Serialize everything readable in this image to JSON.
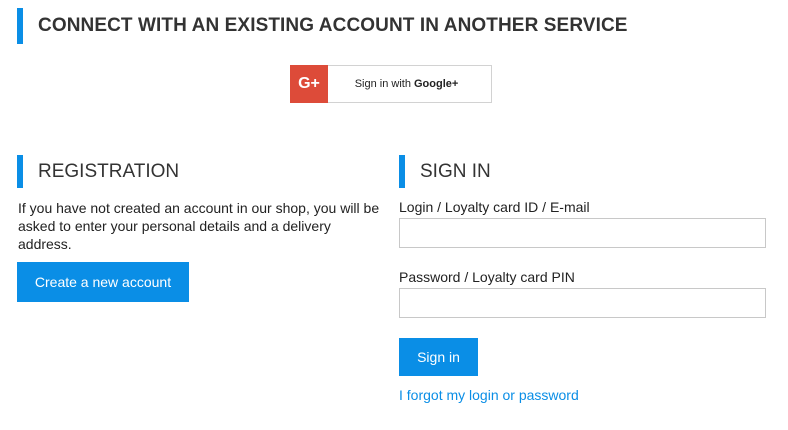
{
  "connect": {
    "title": "CONNECT WITH AN EXISTING ACCOUNT IN ANOTHER SERVICE",
    "google_button": {
      "logo_text": "G+",
      "prefix": "Sign in with ",
      "brand": "Google+",
      "brand_color": "#dd4b39"
    }
  },
  "registration": {
    "title": "REGISTRATION",
    "description": "If you have not created an account in our shop, you will be asked to enter your personal details and a delivery address.",
    "create_button": "Create a new account"
  },
  "signin": {
    "title": "SIGN IN",
    "login_label": "Login / Loyalty card ID / E-mail",
    "login_value": "",
    "password_label": "Password / Loyalty card PIN",
    "password_value": "",
    "submit_button": "Sign in",
    "forgot_link": "I forgot my login or password"
  },
  "colors": {
    "accent": "#0a8ee6",
    "google_red": "#dd4b39"
  }
}
